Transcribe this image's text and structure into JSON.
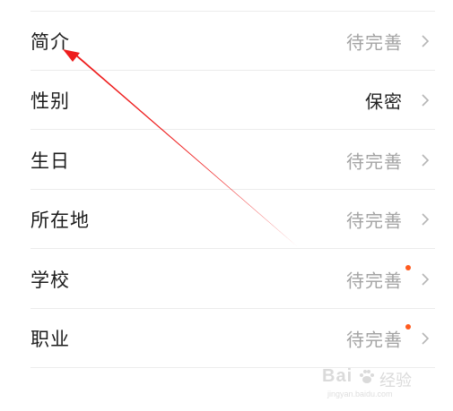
{
  "profile_list": {
    "rows": [
      {
        "label": "简介",
        "value": "待完善",
        "filled": false,
        "new_dot": false
      },
      {
        "label": "性别",
        "value": "保密",
        "filled": true,
        "new_dot": false
      },
      {
        "label": "生日",
        "value": "待完善",
        "filled": false,
        "new_dot": false
      },
      {
        "label": "所在地",
        "value": "待完善",
        "filled": false,
        "new_dot": false
      },
      {
        "label": "学校",
        "value": "待完善",
        "filled": false,
        "new_dot": true
      },
      {
        "label": "职业",
        "value": "待完善",
        "filled": false,
        "new_dot": true
      }
    ],
    "chevron_icon": "chevron-right-icon"
  },
  "colors": {
    "label": "#1c1c1c",
    "placeholder_value": "#a3a3a3",
    "filled_value": "#222222",
    "divider": "#ececec",
    "new_dot": "#ff5a1e",
    "annotation_arrow": "#ee1c1c"
  },
  "watermark": {
    "brand": "Bai",
    "product": "经验",
    "url": "jingyan.baidu.com",
    "icon": "paw-icon"
  }
}
